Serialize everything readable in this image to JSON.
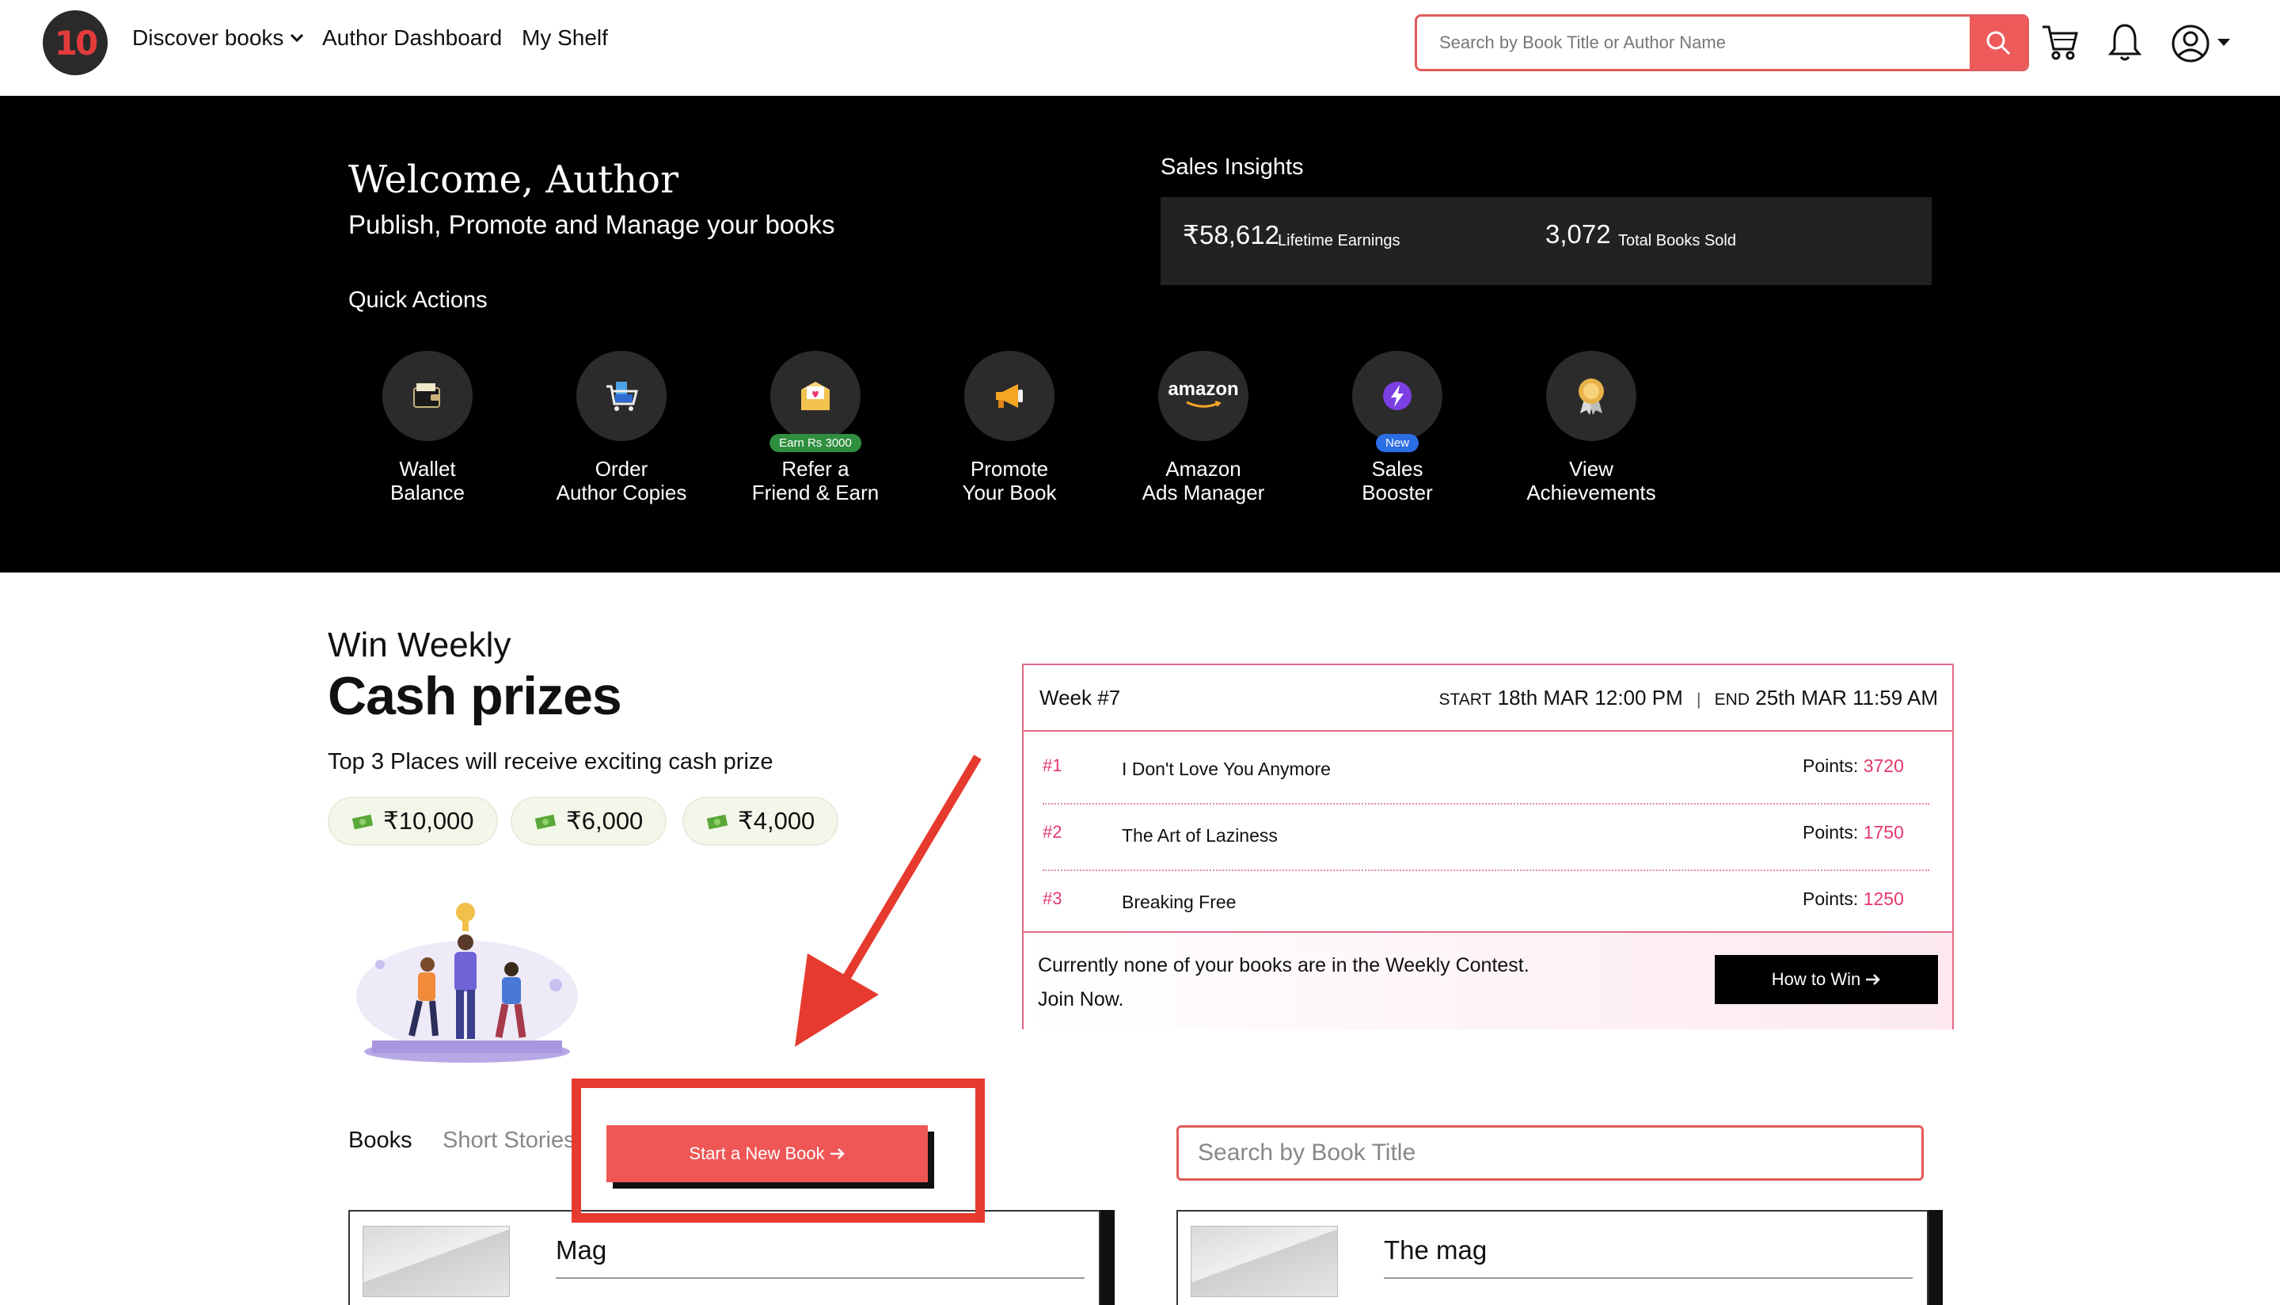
{
  "header": {
    "logo_text": "10",
    "nav": [
      {
        "label": "Discover books",
        "has_dropdown": true
      },
      {
        "label": "Author Dashboard"
      },
      {
        "label": "My Shelf"
      }
    ],
    "search_placeholder": "Search by Book Title or Author Name",
    "icons": [
      "search-icon",
      "cart-icon",
      "bell-icon",
      "user-icon",
      "caret-down-icon"
    ]
  },
  "hero": {
    "welcome": "Welcome, Author",
    "tagline": "Publish, Promote and Manage your books",
    "quick_actions_title": "Quick Actions",
    "sales_insights_title": "Sales Insights",
    "lifetime_earnings_value": "₹58,612",
    "lifetime_earnings_label": "Lifetime Earnings",
    "books_sold_value": "3,072",
    "books_sold_label": "Total Books Sold",
    "quick_actions": [
      {
        "line1": "Wallet",
        "line2": "Balance",
        "icon": "wallet-icon",
        "badge": ""
      },
      {
        "line1": "Order",
        "line2": "Author Copies",
        "icon": "cart-books-icon",
        "badge": ""
      },
      {
        "line1": "Refer a",
        "line2": "Friend & Earn",
        "icon": "envelope-heart-icon",
        "badge": "Earn Rs 3000"
      },
      {
        "line1": "Promote",
        "line2": "Your Book",
        "icon": "megaphone-icon",
        "badge": ""
      },
      {
        "line1": "Amazon",
        "line2": "Ads Manager",
        "icon": "amazon-logo",
        "logo_text": "amazon",
        "badge": ""
      },
      {
        "line1": "Sales",
        "line2": "Booster",
        "icon": "lightning-icon",
        "badge": "New"
      },
      {
        "line1": "View",
        "line2": "Achievements",
        "icon": "award-icon",
        "badge": ""
      }
    ]
  },
  "contest": {
    "heading_small": "Win Weekly",
    "heading_big": "Cash prizes",
    "subtitle": "Top 3 Places will receive exciting cash prize",
    "prizes": [
      "₹10,000",
      "₹6,000",
      "₹4,000"
    ],
    "week_label": "Week #7",
    "start_label": "START",
    "start_value": "18th MAR 12:00 PM",
    "separator": "|",
    "end_label": "END",
    "end_value": "25th MAR 11:59 AM",
    "points_label": "Points:",
    "leaders": [
      {
        "rank": "#1",
        "title": "I Don't Love You Anymore",
        "points": "3720"
      },
      {
        "rank": "#2",
        "title": "The Art of Laziness",
        "points": "1750"
      },
      {
        "rank": "#3",
        "title": "Breaking Free",
        "points": "1250"
      }
    ],
    "footer_line1": "Currently none of your books are in the Weekly Contest.",
    "footer_line2": "Join Now.",
    "how_to_win": "How to Win"
  },
  "books_section": {
    "tabs": [
      "Books",
      "Short Stories"
    ],
    "start_button": "Start a New Book",
    "search_placeholder": "Search by Book Title",
    "books": [
      {
        "title": "Mag"
      },
      {
        "title": "The mag"
      }
    ]
  },
  "colors": {
    "accent": "#ee5a5a",
    "annotation_red": "#e63a2e",
    "rank_pink": "#e5386b",
    "hero_bg": "#000000"
  }
}
